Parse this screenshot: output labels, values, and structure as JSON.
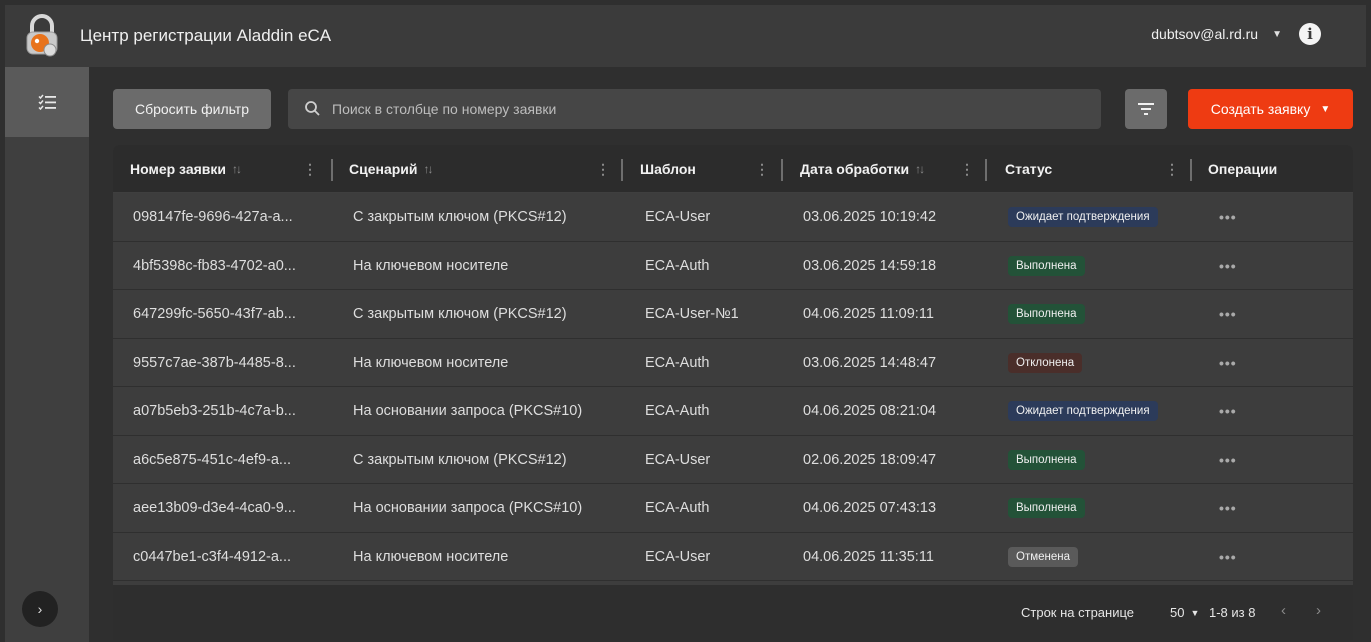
{
  "header": {
    "title": "Центр регистрации Aladdin eCA",
    "user": "dubtsov@al.rd.ru"
  },
  "toolbar": {
    "reset_label": "Сбросить фильтр",
    "search_placeholder": "Поиск в столбце по номеру заявки",
    "create_label": "Создать заявку"
  },
  "table": {
    "columns": [
      "Номер заявки",
      "Сценарий",
      "Шаблон",
      "Дата обработки",
      "Статус",
      "Операции"
    ],
    "rows": [
      {
        "id": "098147fe-9696-427a-a...",
        "scenario": "С закрытым ключом (PKCS#12)",
        "template": "ECA-User",
        "date": "03.06.2025 10:19:42",
        "status": "Ожидает подтверждения",
        "status_color": "#2c3b5a",
        "ops": "•••"
      },
      {
        "id": "4bf5398c-fb83-4702-a0...",
        "scenario": "На ключевом носителе",
        "template": "ECA-Auth",
        "date": "03.06.2025 14:59:18",
        "status": "Выполнена",
        "status_color": "#235238",
        "ops": "•••"
      },
      {
        "id": "647299fc-5650-43f7-ab...",
        "scenario": "С закрытым ключом (PKCS#12)",
        "template": "ECA-User-№1",
        "date": "04.06.2025 11:09:11",
        "status": "Выполнена",
        "status_color": "#235238",
        "ops": "•••"
      },
      {
        "id": "9557c7ae-387b-4485-8...",
        "scenario": "На ключевом носителе",
        "template": "ECA-Auth",
        "date": "03.06.2025 14:48:47",
        "status": "Отклонена",
        "status_color": "#4a2e2a",
        "ops": "•••"
      },
      {
        "id": "a07b5eb3-251b-4c7a-b...",
        "scenario": "На основании запроса (PKCS#10)",
        "template": "ECA-Auth",
        "date": "04.06.2025 08:21:04",
        "status": "Ожидает подтверждения",
        "status_color": "#2c3b5a",
        "ops": "•••"
      },
      {
        "id": "a6c5e875-451c-4ef9-a...",
        "scenario": "С закрытым ключом (PKCS#12)",
        "template": "ECA-User",
        "date": "02.06.2025 18:09:47",
        "status": "Выполнена",
        "status_color": "#235238",
        "ops": "•••"
      },
      {
        "id": "aee13b09-d3e4-4ca0-9...",
        "scenario": "На основании запроса (PKCS#10)",
        "template": "ECA-Auth",
        "date": "04.06.2025 07:43:13",
        "status": "Выполнена",
        "status_color": "#235238",
        "ops": "•••"
      },
      {
        "id": "c0447be1-c3f4-4912-a...",
        "scenario": "На ключевом носителе",
        "template": "ECA-User",
        "date": "04.06.2025 11:35:11",
        "status": "Отменена",
        "status_color": "#5a5a5a",
        "ops": "•••"
      }
    ]
  },
  "pagination": {
    "rows_per_page_label": "Строк на странице",
    "rows_per_page": "50",
    "range": "1-8 из 8"
  },
  "colors": {
    "accent": "#ee3b12",
    "background": "#2f2f2f"
  }
}
